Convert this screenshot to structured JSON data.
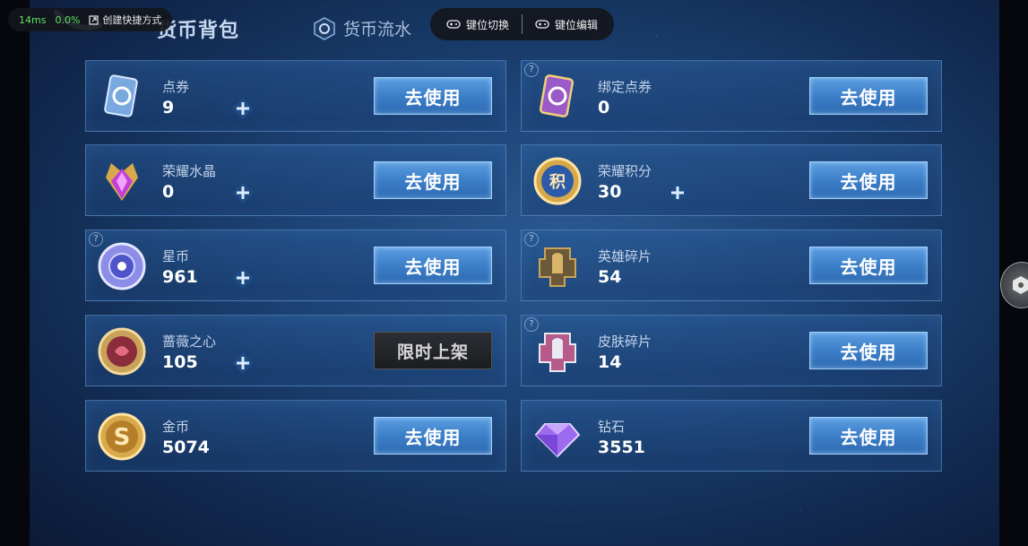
{
  "header": {
    "active_tab": "货币背包",
    "flow_tab": "货币流水"
  },
  "overlay": {
    "ping": "14ms",
    "loss": "0.0%",
    "shortcut": "创建快捷方式",
    "key_switch": "键位切换",
    "key_edit": "键位编辑"
  },
  "cards": [
    {
      "name": "点券",
      "count": "9",
      "action": "去使用"
    },
    {
      "name": "绑定点券",
      "count": "0",
      "action": "去使用"
    },
    {
      "name": "荣耀水晶",
      "count": "0",
      "action": "去使用"
    },
    {
      "name": "荣耀积分",
      "count": "30",
      "action": "去使用"
    },
    {
      "name": "星币",
      "count": "961",
      "action": "去使用"
    },
    {
      "name": "英雄碎片",
      "count": "54",
      "action": "去使用"
    },
    {
      "name": "蔷薇之心",
      "count": "105",
      "action": "限时上架"
    },
    {
      "name": "皮肤碎片",
      "count": "14",
      "action": "去使用"
    },
    {
      "name": "金币",
      "count": "5074",
      "action": "去使用"
    },
    {
      "name": "钻石",
      "count": "3551",
      "action": "去使用"
    }
  ],
  "help_mark": "?",
  "colors": {
    "button": "#3a7cc6",
    "button_border": "#9fd0ff",
    "card_border": "#78aae6",
    "background": "#1c4274"
  },
  "icons": [
    "back-icon",
    "coin-flow-icon",
    "gamepad-icon",
    "shortcut-icon",
    "plus-icon",
    "help-icon"
  ]
}
